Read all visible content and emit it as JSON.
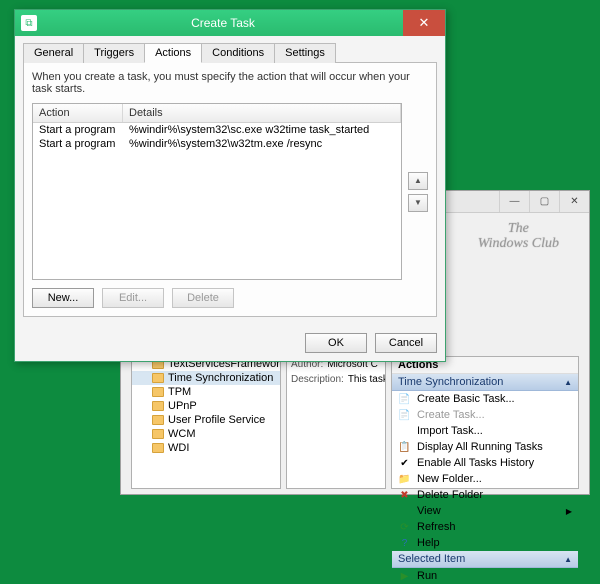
{
  "dialog": {
    "title": "Create Task",
    "tabs": [
      "General",
      "Triggers",
      "Actions",
      "Conditions",
      "Settings"
    ],
    "active_tab_index": 2,
    "instruction": "When you create a task, you must specify the action that will occur when your task starts.",
    "columns": {
      "action": "Action",
      "details": "Details"
    },
    "rows": [
      {
        "action": "Start a program",
        "details": "%windir%\\system32\\sc.exe w32time task_started"
      },
      {
        "action": "Start a program",
        "details": "%windir%\\system32\\w32tm.exe /resync"
      }
    ],
    "buttons": {
      "new": "New...",
      "edit": "Edit...",
      "delete": "Delete",
      "ok": "OK",
      "cancel": "Cancel"
    }
  },
  "bg": {
    "watermark_line1": "The",
    "watermark_line2": "Windows Club",
    "tree": [
      {
        "label": "TextServicesFramework",
        "selected": false
      },
      {
        "label": "Time Synchronization",
        "selected": true
      },
      {
        "label": "TPM",
        "selected": false
      },
      {
        "label": "UPnP",
        "selected": false
      },
      {
        "label": "User Profile Service",
        "selected": false
      },
      {
        "label": "WCM",
        "selected": false
      },
      {
        "label": "WDI",
        "selected": false
      }
    ],
    "detail": {
      "author_lbl": "Author:",
      "author_val": "Microsoft C",
      "desc_lbl": "Description:",
      "desc_val": "This task pe"
    },
    "actions_title": "Actions",
    "section1": "Time Synchronization",
    "section2": "Selected Item",
    "items1": [
      {
        "icon": "📄",
        "label": "Create Basic Task...",
        "disabled": false,
        "name": "action-create-basic-task"
      },
      {
        "icon": "📄",
        "label": "Create Task...",
        "disabled": true,
        "name": "action-create-task"
      },
      {
        "icon": "",
        "label": "Import Task...",
        "disabled": false,
        "name": "action-import-task"
      },
      {
        "icon": "📋",
        "label": "Display All Running Tasks",
        "disabled": false,
        "name": "action-display-running"
      },
      {
        "icon": "✔",
        "label": "Enable All Tasks History",
        "disabled": false,
        "name": "action-enable-history"
      },
      {
        "icon": "📁",
        "label": "New Folder...",
        "disabled": false,
        "name": "action-new-folder"
      },
      {
        "icon": "✖",
        "label": "Delete Folder",
        "disabled": false,
        "name": "action-delete-folder",
        "iconcolor": "#c0392b"
      },
      {
        "icon": "",
        "label": "View",
        "disabled": false,
        "name": "action-view",
        "submenu": true
      },
      {
        "icon": "⟳",
        "label": "Refresh",
        "disabled": false,
        "name": "action-refresh",
        "iconcolor": "#2a8f2a"
      },
      {
        "icon": "?",
        "label": "Help",
        "disabled": false,
        "name": "action-help",
        "iconcolor": "#2a6fb5"
      }
    ],
    "items2": [
      {
        "icon": "▶",
        "label": "Run",
        "disabled": false,
        "name": "action-run",
        "iconcolor": "#2a8f2a"
      }
    ]
  }
}
